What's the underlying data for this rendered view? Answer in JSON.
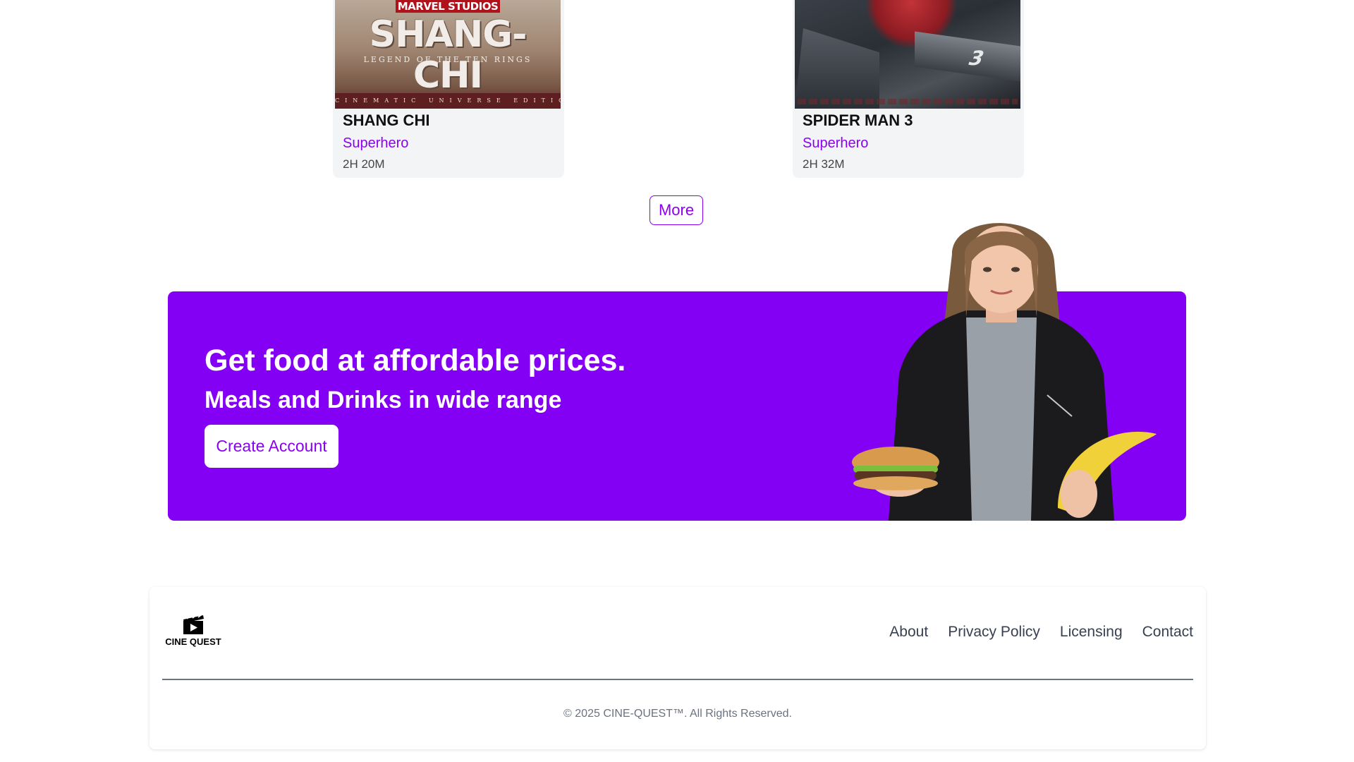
{
  "movies": [
    {
      "title": "SHANG CHI",
      "genre": "Superhero",
      "duration": "2H 20M",
      "poster": {
        "studio": "MARVEL STUDIOS",
        "big_title": "SHANG-CHI",
        "sub_title": "LEGEND OF THE TEN RINGS",
        "strip": "CINEMATIC UNIVERSE EDITION"
      }
    },
    {
      "title": "SPIDER MAN 3",
      "genre": "Superhero",
      "duration": "2H 32M",
      "poster": {
        "number": "3"
      }
    }
  ],
  "more_button": "More",
  "promo": {
    "headline": "Get food at affordable prices.",
    "subheadline": "Meals and Drinks in wide range",
    "cta": "Create Account"
  },
  "footer": {
    "logo_text": "CINE QUEST",
    "links": [
      "About",
      "Privacy Policy",
      "Licensing",
      "Contact"
    ],
    "copyright": "© 2025 CINE-QUEST™. All Rights Reserved."
  },
  "colors": {
    "accent": "#8b00f0",
    "banner": "#8400f5",
    "card_bg": "#f3f4f6"
  }
}
